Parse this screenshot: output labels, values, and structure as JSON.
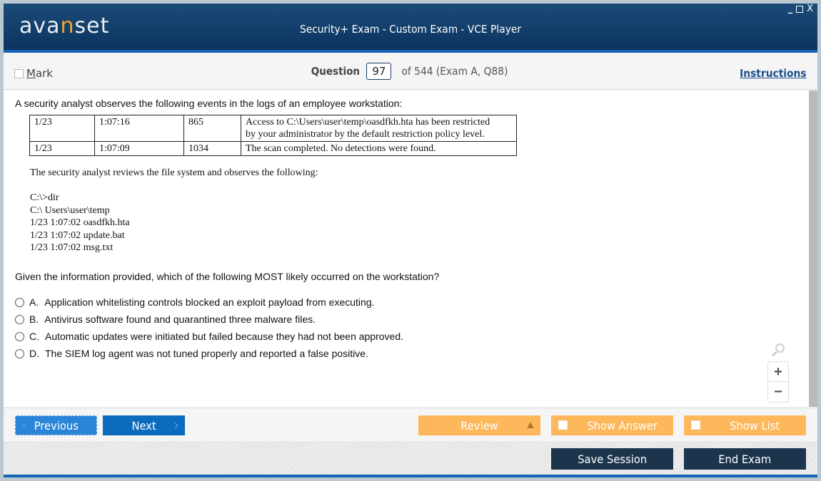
{
  "titlebar": {
    "logo_pre": "ava",
    "logo_accent": "n",
    "logo_post": "set",
    "title": "Security+ Exam - Custom Exam - VCE Player",
    "controls": {
      "minimize": "_",
      "close": "X"
    }
  },
  "question_bar": {
    "mark_label_first": "M",
    "mark_label_rest": "ark",
    "question_label": "Question",
    "question_number": "97",
    "question_rest": "of 544 (Exam A, Q88)",
    "instructions_label": "Instructions"
  },
  "question": {
    "intro": "A security analyst observes the following events in the logs of an employee workstation:",
    "log_table": [
      {
        "date": "1/23",
        "time": "1:07:16",
        "event_id": "865",
        "message_line1": "Access to C:\\Users\\user\\temp\\oasdfkh.hta has been restricted",
        "message_line2": "by your administrator by the default restriction policy level."
      },
      {
        "date": "1/23",
        "time": "1:07:09",
        "event_id": "1034",
        "message_line1": "The scan completed. No detections were found.",
        "message_line2": ""
      }
    ],
    "review_text": "The security analyst reviews the file system and observes the following:",
    "dir_listing": [
      "C:\\>dir",
      "C:\\ Users\\user\\temp",
      "1/23 1:07:02 oasdfkh.hta",
      "1/23 1:07:02 update.bat",
      "1/23 1:07:02 msg.txt"
    ],
    "prompt": "Given the information provided, which of the following MOST likely occurred on the workstation?",
    "options": [
      {
        "letter": "A.",
        "text": "Application whitelisting controls blocked an exploit payload from executing."
      },
      {
        "letter": "B.",
        "text": "Antivirus software found and quarantined three malware files."
      },
      {
        "letter": "C.",
        "text": "Automatic updates were initiated but failed because they had not been approved."
      },
      {
        "letter": "D.",
        "text": "The SIEM log agent was not tuned properly and reported a false positive."
      }
    ]
  },
  "zoom_controls": {
    "plus": "+",
    "minus": "−"
  },
  "nav": {
    "previous": "Previous",
    "next": "Next",
    "prev_chevron": "‹",
    "next_chevron": "›",
    "review": "Review",
    "show_answer": "Show Answer",
    "show_list": "Show List"
  },
  "footer": {
    "save_session": "Save Session",
    "end_exam": "End Exam"
  },
  "colors": {
    "header_blue": "#0c3460",
    "accent_blue": "#1565b8",
    "button_blue": "#0d6bbd",
    "orange": "#fdb85b",
    "dark_navy": "#1c354d",
    "logo_accent": "#f5a623"
  }
}
